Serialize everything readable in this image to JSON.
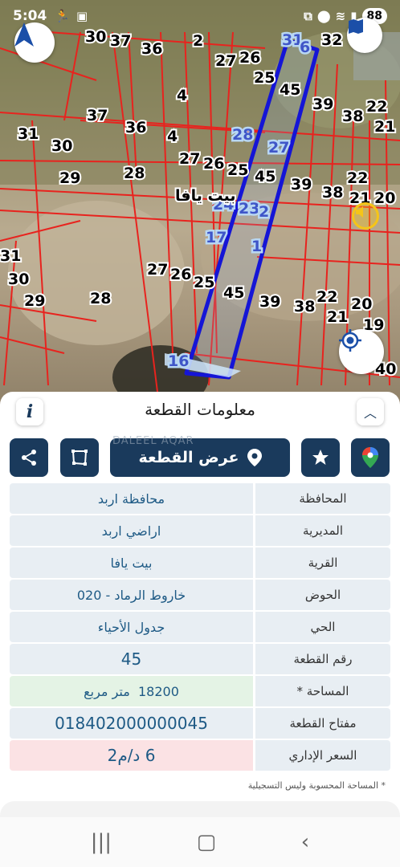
{
  "status_bar": {
    "time": "5:04",
    "battery": "88"
  },
  "map": {
    "village_label": "بيت يافا",
    "parcel_numbers_black": [
      "30",
      "37",
      "36",
      "2",
      "27",
      "26",
      "25",
      "4",
      "37",
      "36",
      "4",
      "31",
      "30",
      "29",
      "28",
      "27",
      "26",
      "25",
      "45",
      "39",
      "38",
      "22",
      "21",
      "39",
      "45",
      "22",
      "38",
      "21",
      "20",
      "31",
      "30",
      "29",
      "28",
      "27",
      "26",
      "25",
      "45",
      "39",
      "38",
      "22",
      "21",
      "20",
      "19",
      "40",
      "32"
    ],
    "parcel_numbers_blue": [
      "31",
      "6",
      "28",
      "27",
      "24",
      "23",
      "2",
      "17",
      "1",
      "16"
    ]
  },
  "sheet": {
    "title": "معلومات القطعة",
    "info_icon": "info-icon",
    "show_parcel_label": "عرض القطعة",
    "watermark": "DALEEL AQAR",
    "rows": [
      {
        "label": "المحافظة",
        "value": "محافظة اربد"
      },
      {
        "label": "المديرية",
        "value": "اراضي اربد"
      },
      {
        "label": "القرية",
        "value": "بيت يافا"
      },
      {
        "label": "الحوض",
        "value": "خاروط الرماد - 020"
      },
      {
        "label": "الحي",
        "value": "جدول الأحياء"
      },
      {
        "label": "رقم القطعة",
        "value": "45"
      },
      {
        "label": "المساحة *",
        "value": "18200  متر مربع"
      },
      {
        "label": "مفتاح القطعة",
        "value": "018402000000045"
      },
      {
        "label": "السعر الإداري",
        "value": "6 د/م2"
      }
    ],
    "note": "* المساحة المحسوبة وليس التسجيلية"
  },
  "colors": {
    "primary": "#1a3a5c",
    "parcel_line": "#e8231e",
    "selected_parcel": "#1515d6"
  }
}
